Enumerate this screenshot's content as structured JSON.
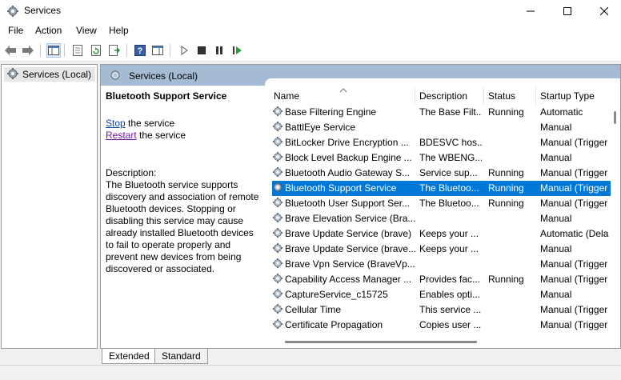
{
  "window": {
    "title": "Services"
  },
  "menu": [
    "File",
    "Action",
    "View",
    "Help"
  ],
  "toolbar": {
    "icons": [
      "back-arrow-icon",
      "forward-arrow-icon",
      "show-hide-tree-icon",
      "properties-icon",
      "refresh-icon",
      "export-list-icon",
      "help-icon",
      "toggle-panel-icon",
      "start-service-icon",
      "stop-service-icon",
      "pause-service-icon",
      "restart-service-icon"
    ]
  },
  "tree": {
    "root_label": "Services (Local)"
  },
  "pane": {
    "header": "Services (Local)"
  },
  "details": {
    "title": "Bluetooth Support Service",
    "stop_link": "Stop",
    "stop_suffix": " the service",
    "restart_link": "Restart",
    "restart_suffix": " the service",
    "description_label": "Description:",
    "description": "The Bluetooth service supports discovery and association of remote Bluetooth devices.  Stopping or disabling this service may cause already installed Bluetooth devices to fail to operate properly and prevent new devices from being discovered or associated."
  },
  "columns": {
    "name": "Name",
    "description": "Description",
    "status": "Status",
    "startup": "Startup Type"
  },
  "rows": [
    {
      "name": "Base Filtering Engine",
      "desc": "The Base Filt...",
      "status": "Running",
      "startup": "Automatic"
    },
    {
      "name": "BattlEye Service",
      "desc": "",
      "status": "",
      "startup": "Manual"
    },
    {
      "name": "BitLocker Drive Encryption ...",
      "desc": "BDESVC hos...",
      "status": "",
      "startup": "Manual (Trigger"
    },
    {
      "name": "Block Level Backup Engine ...",
      "desc": "The WBENG...",
      "status": "",
      "startup": "Manual"
    },
    {
      "name": "Bluetooth Audio Gateway S...",
      "desc": "Service sup...",
      "status": "Running",
      "startup": "Manual (Trigger"
    },
    {
      "name": "Bluetooth Support Service",
      "desc": "The Bluetoo...",
      "status": "Running",
      "startup": "Manual (Trigger",
      "selected": true
    },
    {
      "name": "Bluetooth User Support Ser...",
      "desc": "The Bluetoo...",
      "status": "Running",
      "startup": "Manual (Trigger"
    },
    {
      "name": "Brave Elevation Service (Bra...",
      "desc": "",
      "status": "",
      "startup": "Manual"
    },
    {
      "name": "Brave Update Service (brave)",
      "desc": "Keeps your ...",
      "status": "",
      "startup": "Automatic (Dela"
    },
    {
      "name": "Brave Update Service (brave...",
      "desc": "Keeps your ...",
      "status": "",
      "startup": "Manual"
    },
    {
      "name": "Brave Vpn Service (BraveVp...",
      "desc": "",
      "status": "",
      "startup": "Manual (Trigger"
    },
    {
      "name": "Capability Access Manager ...",
      "desc": "Provides fac...",
      "status": "Running",
      "startup": "Manual (Trigger"
    },
    {
      "name": "CaptureService_c15725",
      "desc": "Enables opti...",
      "status": "",
      "startup": "Manual"
    },
    {
      "name": "Cellular Time",
      "desc": "This service ...",
      "status": "",
      "startup": "Manual (Trigger"
    },
    {
      "name": "Certificate Propagation",
      "desc": "Copies user ...",
      "status": "",
      "startup": "Manual (Trigger"
    }
  ],
  "bottom_tabs": [
    "Extended",
    "Standard"
  ],
  "colors": {
    "selection": "#0078d7",
    "pane_header": "#a5bad3",
    "link": "#0645ad",
    "visited_link": "#6a1b9a"
  }
}
